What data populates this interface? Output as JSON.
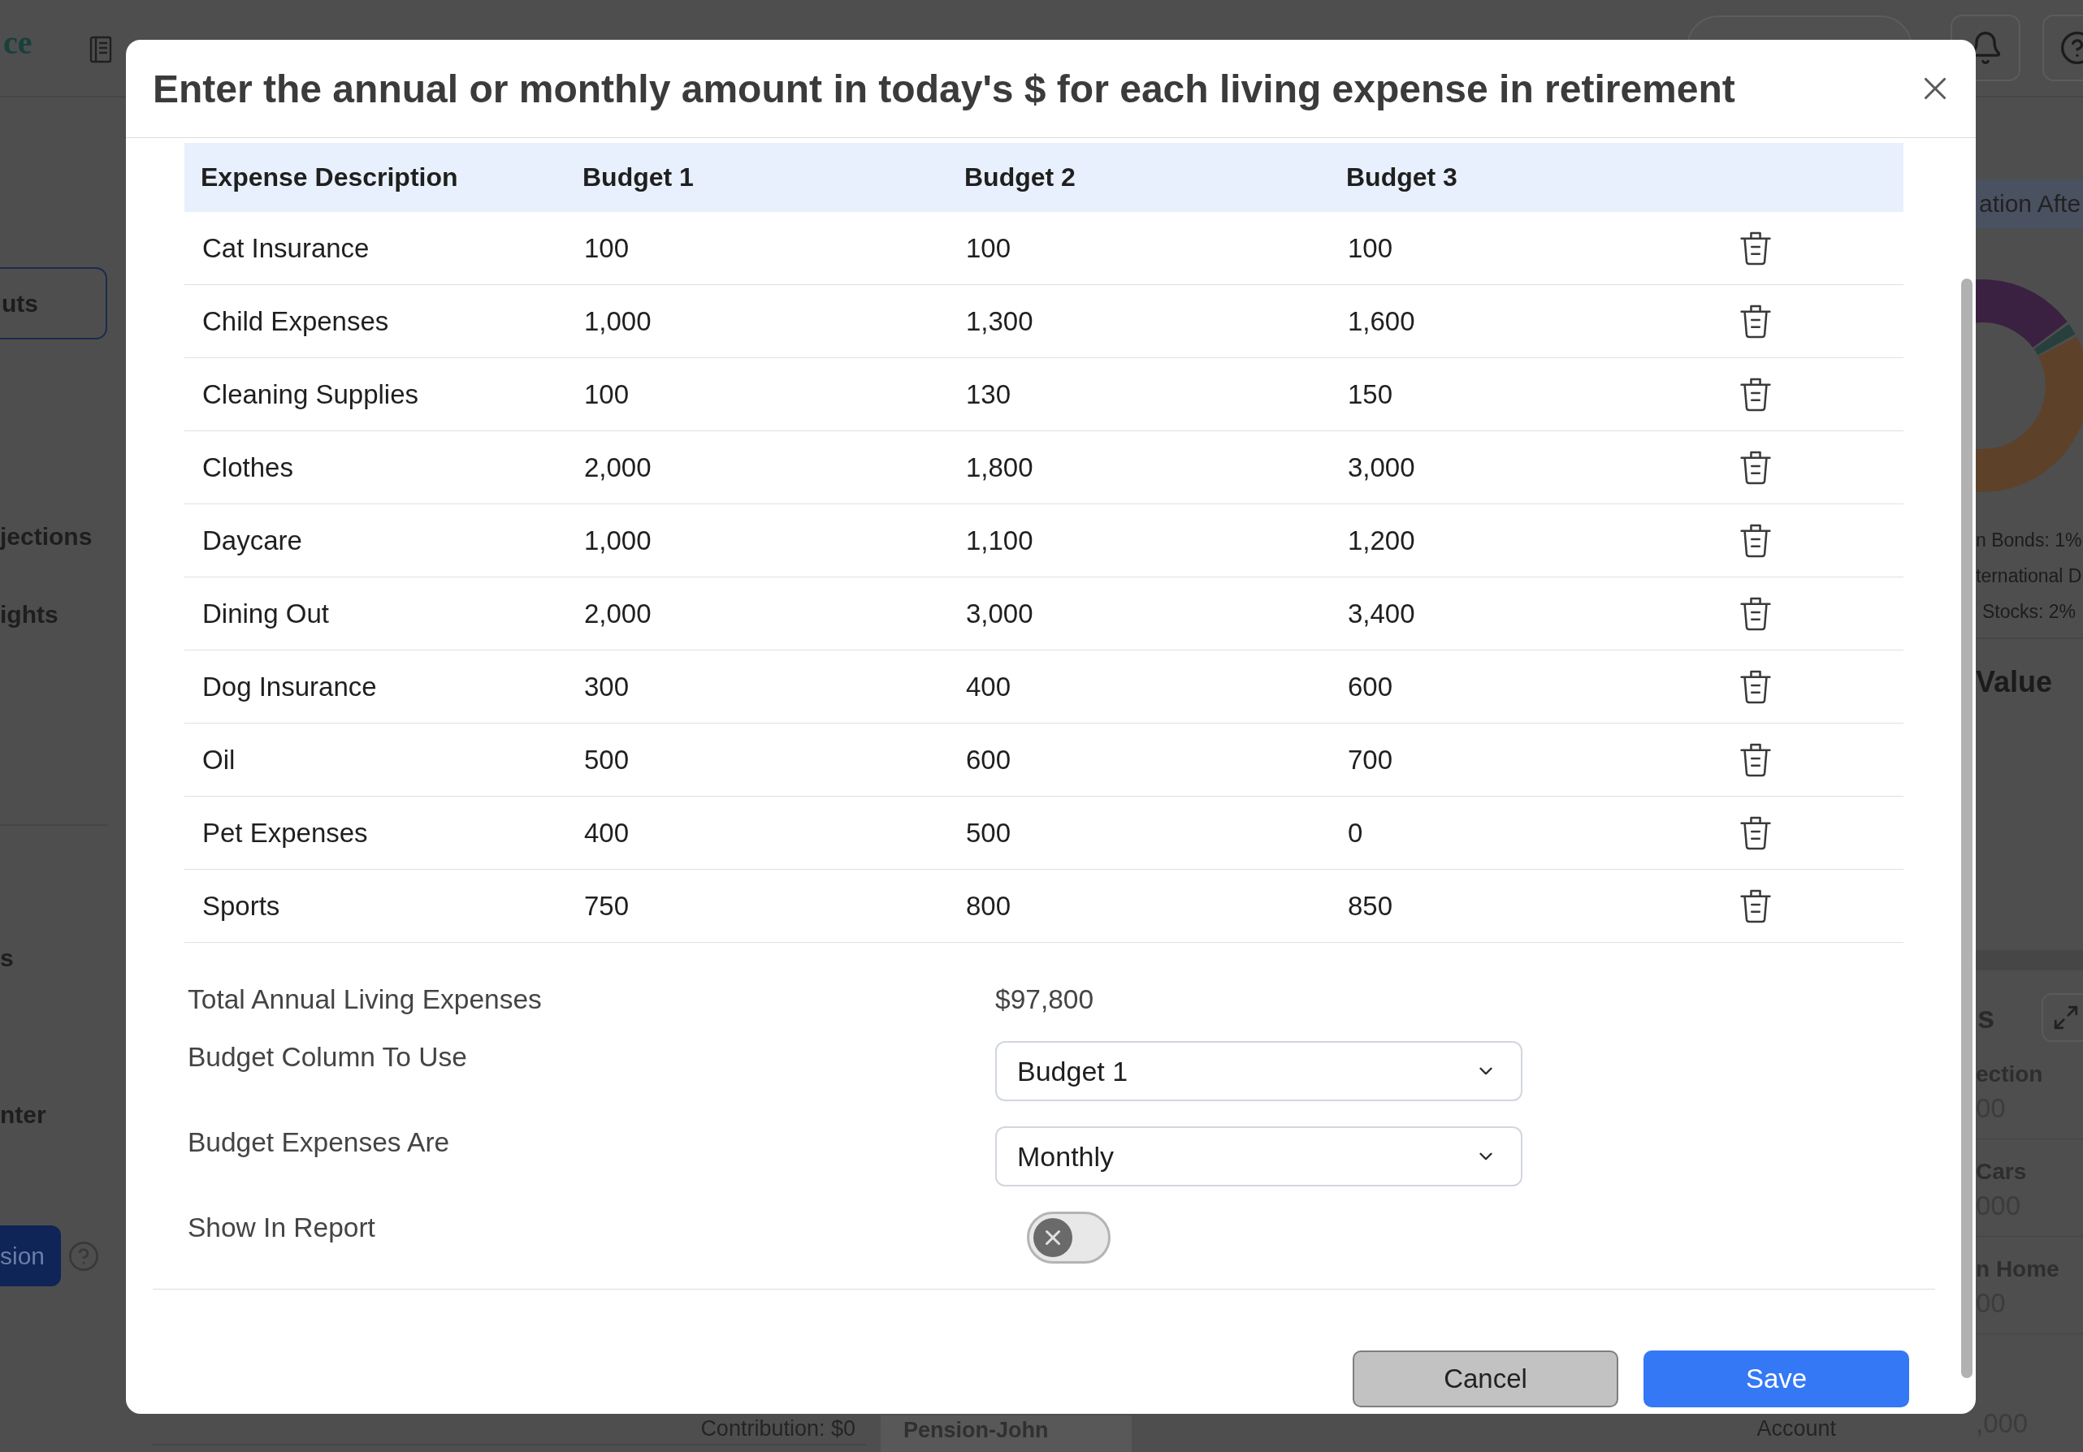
{
  "background": {
    "header": {
      "logo": "ce"
    },
    "sidebar": {
      "top_button": "uts",
      "links": [
        "jections",
        "ights"
      ],
      "links_lower": [
        "s",
        "nter"
      ],
      "bottom_button": "sion"
    },
    "bottom_row": {
      "contribution": "Contribution: $0",
      "pension_card": "Pension-John",
      "account": "Account"
    },
    "right_panel": {
      "allocation_title": "ation Afte",
      "legend": [
        "n Bonds: 1%",
        "ternational D",
        "Stocks: 2%"
      ],
      "value_title": "Value",
      "accounts_title": "s",
      "accounts": [
        {
          "name": "ection",
          "amount": "00"
        },
        {
          "name": "Cars",
          "amount": "000"
        },
        {
          "name": "n Home",
          "amount": "00"
        }
      ],
      "last_amount": ",000"
    }
  },
  "modal": {
    "title": "Enter the annual or monthly amount in today's $ for each living expense in retirement",
    "table": {
      "columns": [
        "Expense Description",
        "Budget 1",
        "Budget 2",
        "Budget 3"
      ],
      "rows": [
        {
          "cells": [
            "Cat Insurance",
            "100",
            "100",
            "100"
          ]
        },
        {
          "cells": [
            "Child Expenses",
            "1,000",
            "1,300",
            "1,600"
          ]
        },
        {
          "cells": [
            "Cleaning Supplies",
            "100",
            "130",
            "150"
          ]
        },
        {
          "cells": [
            "Clothes",
            "2,000",
            "1,800",
            "3,000"
          ]
        },
        {
          "cells": [
            "Daycare",
            "1,000",
            "1,100",
            "1,200"
          ]
        },
        {
          "cells": [
            "Dining Out",
            "2,000",
            "3,000",
            "3,400"
          ]
        },
        {
          "cells": [
            "Dog Insurance",
            "300",
            "400",
            "600"
          ]
        },
        {
          "cells": [
            "Oil",
            "500",
            "600",
            "700"
          ]
        },
        {
          "cells": [
            "Pet Expenses",
            "400",
            "500",
            "0"
          ]
        },
        {
          "cells": [
            "Sports",
            "750",
            "800",
            "850"
          ]
        }
      ]
    },
    "total": {
      "label": "Total Annual Living Expenses",
      "value": "$97,800"
    },
    "fields": [
      {
        "label": "Budget Column To Use",
        "kind": "select",
        "value": "Budget 1"
      },
      {
        "label": "Budget Expenses Are",
        "kind": "select",
        "value": "Monthly"
      },
      {
        "label": "Show In Report",
        "kind": "toggle",
        "on": false
      }
    ],
    "buttons": [
      {
        "label": "Cancel",
        "kind": "secondary"
      },
      {
        "label": "Save",
        "kind": "primary"
      }
    ]
  }
}
